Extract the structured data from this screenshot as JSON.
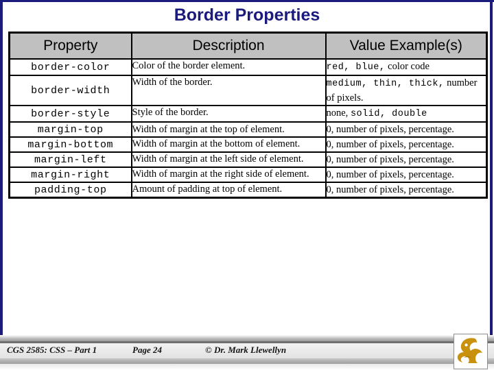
{
  "slide": {
    "title": "Border Properties",
    "title_color": "#1b1b7d",
    "frame_color": "#1b1b7d",
    "header_fill": "#c0c0c0"
  },
  "table": {
    "columns": [
      "Property",
      "Description",
      "Value Example(s)"
    ],
    "rows": [
      {
        "property": "border-color",
        "description": "Color of the border element.",
        "desc_align": "top",
        "value_mono_1": "red, blue,",
        "value_serif_1": "color code",
        "value_mono_2": "",
        "value_serif_2": ""
      },
      {
        "property": "border-width",
        "description": "Width of the border.",
        "desc_align": "top",
        "value_mono_1": "medium, thin, thick,",
        "value_serif_1": "",
        "value_mono_2": "",
        "value_serif_2": "number of pixels."
      },
      {
        "property": "border-style",
        "description": "Style of the border.",
        "desc_align": "top",
        "value_mono_1": "",
        "value_serif_1": "none,",
        "value_mono_2": "solid, double",
        "value_serif_2": ""
      },
      {
        "property": "margin-top",
        "description": "Width of margin at the top of element.",
        "desc_align": "mid",
        "value_mono_1": "",
        "value_serif_1": "0, number of pixels, percentage.",
        "value_mono_2": "",
        "value_serif_2": ""
      },
      {
        "property": "margin-bottom",
        "description": "Width of margin at the bottom of element.",
        "desc_align": "top",
        "value_mono_1": "",
        "value_serif_1": "0, number of pixels, percentage.",
        "value_mono_2": "",
        "value_serif_2": ""
      },
      {
        "property": "margin-left",
        "description": "Width of margin at the left side of element.",
        "desc_align": "top",
        "value_mono_1": "",
        "value_serif_1": "0, number of pixels, percentage.",
        "value_mono_2": "",
        "value_serif_2": ""
      },
      {
        "property": "margin-right",
        "description": "Width of margin at the right side of element.",
        "desc_align": "top",
        "value_mono_1": "",
        "value_serif_1": "0, number of pixels, percentage.",
        "value_mono_2": "",
        "value_serif_2": ""
      },
      {
        "property": "padding-top",
        "description": "Amount of padding at top of element.",
        "desc_align": "top",
        "value_mono_1": "",
        "value_serif_1": "0, number of pixels, percentage.",
        "value_mono_2": "",
        "value_serif_2": ""
      }
    ]
  },
  "footer": {
    "course": "CGS 2585: CSS – Part 1",
    "page": "Page 24",
    "copyright": "© Dr. Mark Llewellyn",
    "logo_name": "ucf-pegasus-logo",
    "logo_color": "#c8920f"
  }
}
